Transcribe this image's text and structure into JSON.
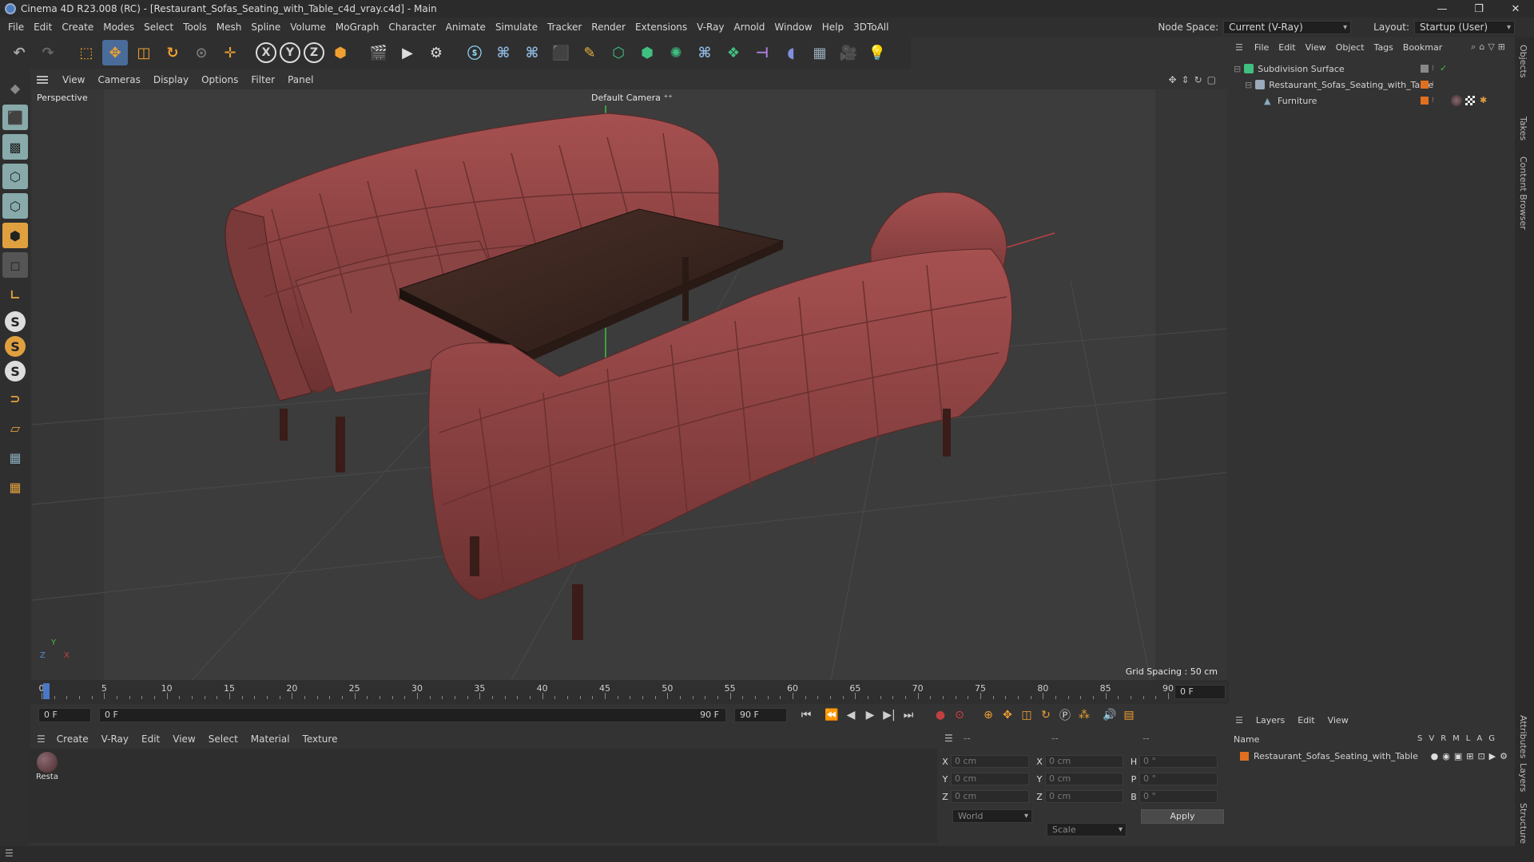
{
  "window": {
    "title": "Cinema 4D R23.008 (RC) - [Restaurant_Sofas_Seating_with_Table_c4d_vray.c4d] - Main",
    "controls": [
      "—",
      "❐",
      "✕"
    ]
  },
  "menubar": {
    "items": [
      "File",
      "Edit",
      "Create",
      "Modes",
      "Select",
      "Tools",
      "Mesh",
      "Spline",
      "Volume",
      "MoGraph",
      "Character",
      "Animate",
      "Simulate",
      "Tracker",
      "Render",
      "Extensions",
      "V-Ray",
      "Arnold",
      "Window",
      "Help",
      "3DToAll"
    ],
    "node_space_label": "Node Space:",
    "node_space_value": "Current (V-Ray)",
    "layout_label": "Layout:",
    "layout_value": "Startup (User)"
  },
  "toolbar": {
    "axis_x": "X",
    "axis_y": "Y",
    "axis_z": "Z"
  },
  "lefttools": {
    "s1": "S",
    "s2": "S",
    "s3": "S"
  },
  "viewport": {
    "menu": [
      "View",
      "Cameras",
      "Display",
      "Options",
      "Filter",
      "Panel"
    ],
    "label": "Perspective",
    "camera": "Default Camera",
    "grid_spacing": "Grid Spacing : 50 cm",
    "axis_x": "X",
    "axis_y": "Y",
    "axis_z": "Z"
  },
  "timeline": {
    "labels": [
      "0",
      "5",
      "10",
      "15",
      "20",
      "25",
      "30",
      "35",
      "40",
      "45",
      "50",
      "55",
      "60",
      "65",
      "70",
      "75",
      "80",
      "85",
      "90"
    ],
    "end_field": "0 F"
  },
  "playbar": {
    "current_frame": "0 F",
    "range_start": "0 F",
    "range_end": "90 F",
    "max_frame": "90 F"
  },
  "material_manager": {
    "menu": [
      "Create",
      "V-Ray",
      "Edit",
      "View",
      "Select",
      "Material",
      "Texture"
    ],
    "materials": [
      {
        "name": "Resta"
      }
    ]
  },
  "coordinates": {
    "header_left": "--",
    "header_mid": "--",
    "header_right": "--",
    "rows": [
      {
        "a": "X",
        "av": "0 cm",
        "b": "X",
        "bv": "0 cm",
        "c": "H",
        "cv": "0 °"
      },
      {
        "a": "Y",
        "av": "0 cm",
        "b": "Y",
        "bv": "0 cm",
        "c": "P",
        "cv": "0 °"
      },
      {
        "a": "Z",
        "av": "0 cm",
        "b": "Z",
        "bv": "0 cm",
        "c": "B",
        "cv": "0 °"
      }
    ],
    "mode": "World",
    "scale": "Scale",
    "apply": "Apply"
  },
  "object_manager": {
    "menu": [
      "File",
      "Edit",
      "View",
      "Object",
      "Tags",
      "Bookmar"
    ],
    "objects": [
      {
        "name": "Subdivision Surface"
      },
      {
        "name": "Restaurant_Sofas_Seating_with_Table"
      },
      {
        "name": "Furniture"
      }
    ]
  },
  "layer_manager": {
    "menu": [
      "Layers",
      "Edit",
      "View"
    ],
    "name_header": "Name",
    "flags": [
      "S",
      "V",
      "R",
      "M",
      "L",
      "A",
      "G"
    ],
    "layers": [
      {
        "name": "Restaurant_Sofas_Seating_with_Table"
      }
    ]
  },
  "side_tabs": [
    "Objects",
    "Takes",
    "Content Browser",
    "Attributes",
    "Layers",
    "Structure"
  ],
  "colors": {
    "sofa": "#8a4040",
    "table": "#3a2620",
    "accent_orange": "#e07020",
    "y_axis": "#40c040"
  }
}
